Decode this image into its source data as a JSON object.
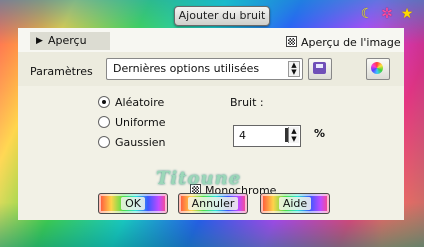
{
  "window": {
    "title": "Ajouter du bruit"
  },
  "corner_icons": [
    "leaf-icon",
    "sparkle-icon",
    "star-icon"
  ],
  "preview": {
    "tab_label": "Aperçu",
    "image_preview_label": "Aperçu de l'image",
    "image_preview_checked": true
  },
  "params": {
    "label": "Paramètres",
    "selected": "Dernières options utilisées"
  },
  "noise_type": {
    "options": [
      {
        "label": "Aléatoire",
        "selected": true
      },
      {
        "label": "Uniforme",
        "selected": false
      },
      {
        "label": "Gaussien",
        "selected": false
      }
    ]
  },
  "noise": {
    "label": "Bruit :",
    "value": "4",
    "unit": "%"
  },
  "monochrome": {
    "label": "Monochrome",
    "checked": true
  },
  "watermark": "Titoune",
  "buttons": {
    "ok": "OK",
    "cancel": "Annuler",
    "help": "Aide"
  },
  "colors": {
    "panel": "#ecebde",
    "content": "#f2f1e6",
    "strip": "#f7f7f2"
  }
}
